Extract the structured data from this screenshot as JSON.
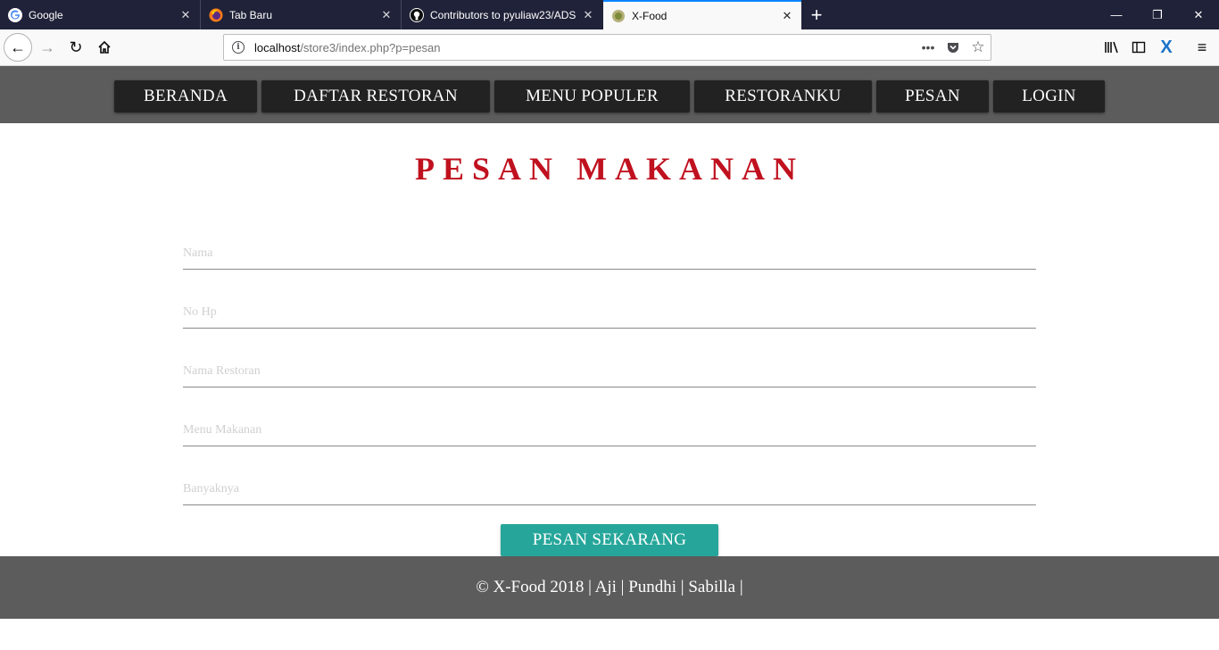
{
  "browser": {
    "tabs": [
      {
        "title": "Google",
        "icon": "google-g-icon"
      },
      {
        "title": "Tab Baru",
        "icon": "firefox-icon"
      },
      {
        "title": "Contributors to pyuliaw23/ADS",
        "icon": "github-icon"
      },
      {
        "title": "X-Food",
        "icon": "xfood-favicon",
        "active": true
      }
    ],
    "url": {
      "host": "localhost",
      "path": "/store3/index.php?p=pesan"
    }
  },
  "site": {
    "menu": [
      {
        "label": "BERANDA"
      },
      {
        "label": "DAFTAR RESTORAN"
      },
      {
        "label": "MENU POPULER"
      },
      {
        "label": "RESTORANKU"
      },
      {
        "label": "PESAN"
      },
      {
        "label": "LOGIN"
      }
    ],
    "title": "PESAN MAKANAN",
    "form": {
      "fields": [
        {
          "placeholder": "Nama"
        },
        {
          "placeholder": "No Hp"
        },
        {
          "placeholder": "Nama Restoran"
        },
        {
          "placeholder": "Menu Makanan"
        },
        {
          "placeholder": "Banyaknya"
        }
      ],
      "submit_label": "PESAN SEKARANG"
    },
    "footer": "© X-Food 2018 | Aji | Pundhi | Sabilla |"
  },
  "colors": {
    "title": "#c0111f",
    "header_bg": "#5c5c5c",
    "menu_bg": "#222222",
    "submit_bg": "#26a69a",
    "tab_strip": "#1f2238"
  }
}
